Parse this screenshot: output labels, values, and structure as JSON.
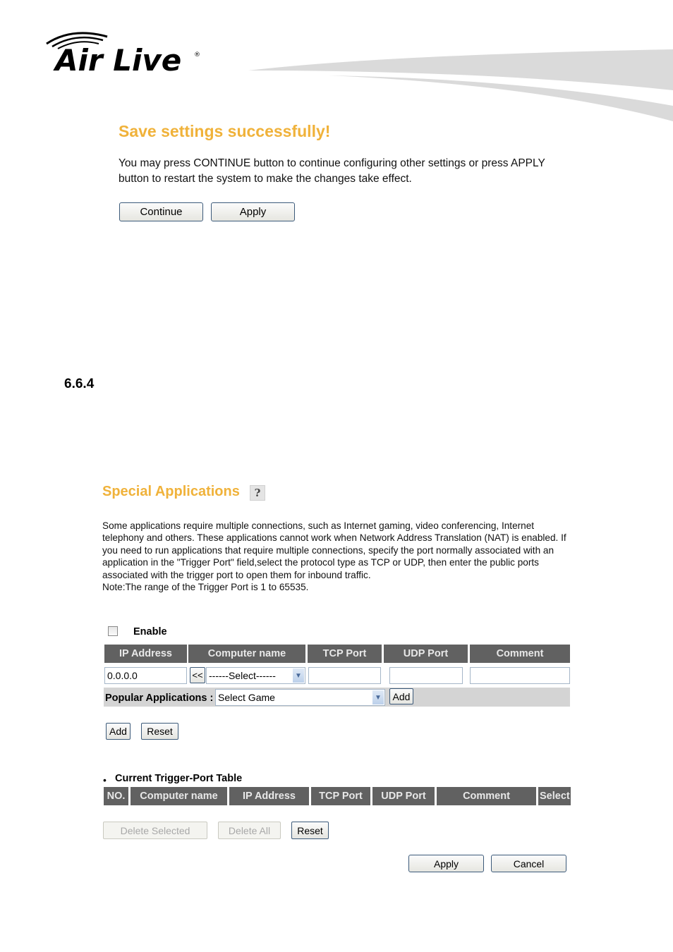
{
  "brand": {
    "name": "Air Live",
    "registered_mark": "®"
  },
  "save_dialog": {
    "title": "Save settings successfully!",
    "message": "You may press CONTINUE button to continue configuring other settings or press APPLY button to restart the system to make the changes take effect.",
    "continue_label": "Continue",
    "apply_label": "Apply"
  },
  "section": {
    "number": "6.6.4"
  },
  "special_apps": {
    "title": "Special Applications",
    "help_icon": "help-icon",
    "description": "Some applications require multiple connections, such as Internet gaming, video conferencing, Internet telephony and others. These applications cannot work when Network Address Translation (NAT) is enabled. If you need to run applications that require multiple connections, specify the port normally associated with an application in the \"Trigger Port\" field,select the protocol type as TCP or UDP, then enter the public ports associated with the trigger port to open them for inbound traffic.",
    "note": "Note:The range of the Trigger Port is 1 to 65535.",
    "enable_label": "Enable",
    "enable_checked": false,
    "columns": [
      "IP Address",
      "Computer name",
      "TCP Port",
      "UDP Port",
      "Comment"
    ],
    "ip_value": "0.0.0.0",
    "copy_button": "<<",
    "computer_select": "------Select------",
    "tcp_value": "",
    "udp_value": "",
    "comment_value": "",
    "popular_label": "Popular Applications :",
    "popular_select": "Select Game",
    "popular_add": "Add",
    "add_label": "Add",
    "reset_label": "Reset"
  },
  "trigger_table": {
    "title": "Current Trigger-Port Table",
    "columns": [
      "NO.",
      "Computer name",
      "IP Address",
      "TCP Port",
      "UDP Port",
      "Comment",
      "Select"
    ],
    "rows": [],
    "delete_selected": "Delete Selected",
    "delete_all": "Delete All",
    "reset": "Reset"
  },
  "footer": {
    "apply": "Apply",
    "cancel": "Cancel"
  },
  "colors": {
    "accent_orange": "#f0b23a",
    "header_gray": "#616161",
    "row_gray": "#d4d4d4"
  }
}
